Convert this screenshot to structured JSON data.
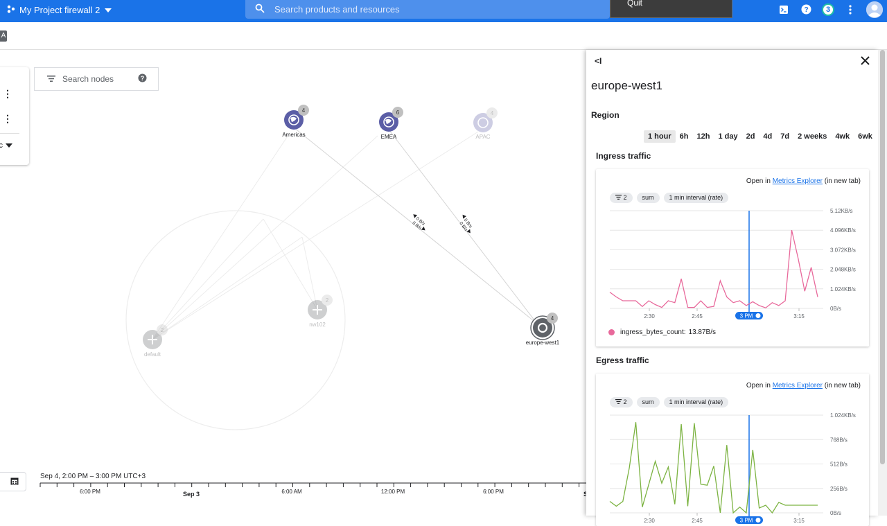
{
  "topbar": {
    "project_name": "My Project firewall 2",
    "search_placeholder": "Search products and resources",
    "quit_label": "Quit",
    "notification_count": "3"
  },
  "chip_label": "A",
  "left_panel": {
    "select_label": "ic"
  },
  "search_nodes_placeholder": "Search nodes",
  "graph": {
    "nodes": [
      {
        "label": "Americas",
        "count": "4"
      },
      {
        "label": "EMEA",
        "count": "6"
      },
      {
        "label": "APAC",
        "count": "4"
      },
      {
        "label": "europe-west1",
        "count": "4"
      },
      {
        "label": "default",
        "count": "2"
      },
      {
        "label": "nw102",
        "count": "2"
      }
    ],
    "edge_labels": [
      "0 B/s",
      "0 B/s",
      "0 B/s",
      "0 B/s"
    ]
  },
  "timeline": {
    "range": "Sep 4, 2:00 PM – 3:00 PM UTC+3",
    "ticks": [
      "6:00 PM",
      "Sep 3",
      "6:00 AM",
      "12:00 PM",
      "6:00 PM",
      "S"
    ]
  },
  "panel": {
    "title": "europe-west1",
    "type": "Region",
    "time_options": [
      "1 hour",
      "6h",
      "12h",
      "1 day",
      "2d",
      "4d",
      "7d",
      "2 weeks",
      "4wk",
      "6wk"
    ],
    "selected_time": "1 hour",
    "open_in_prefix": "Open in",
    "open_in_link": "Metrics Explorer",
    "open_in_suffix": "(in new tab)",
    "chips": [
      "2",
      "sum",
      "1 min interval (rate)"
    ],
    "ingress": {
      "title": "Ingress traffic",
      "legend_label": "ingress_bytes_count:",
      "legend_value": "13.87B/s",
      "color": "#e8699b"
    },
    "egress": {
      "title": "Egress traffic",
      "color": "#7cb342"
    }
  },
  "chart_data": [
    {
      "type": "line",
      "title": "Ingress traffic",
      "x_ticks": [
        "2:30",
        "2:45",
        "3 PM",
        "3:15"
      ],
      "y_ticks": [
        "5.12KB/s",
        "4.096KB/s",
        "3.072KB/s",
        "2.048KB/s",
        "1.024KB/s",
        "0B/s"
      ],
      "ylim": [
        0,
        5.12
      ],
      "y_unit": "KB/s",
      "cursor": "3 PM",
      "series": [
        {
          "values": [
            0.85,
            0.6,
            0.4,
            0.4,
            0.4,
            0.1,
            0.4,
            0.2,
            0.05,
            0.4,
            0.3,
            1.55,
            0.05,
            0.05,
            0.4,
            0.05,
            0.1,
            1.45,
            0.6,
            0.3,
            0.4,
            0.15,
            0.35,
            0.15,
            0.03,
            0.3,
            0.15,
            0.4,
            4.1,
            2.6,
            0.9,
            2.15,
            0.6
          ]
        }
      ]
    },
    {
      "type": "line",
      "title": "Egress traffic",
      "x_ticks": [
        "2:30",
        "2:45",
        "3 PM",
        "3:15"
      ],
      "y_ticks": [
        "1.024KB/s",
        "768B/s",
        "512B/s",
        "256B/s",
        "0B/s"
      ],
      "ylim": [
        0,
        1024
      ],
      "y_unit": "B/s",
      "cursor": "3 PM",
      "series": [
        {
          "values": [
            120,
            70,
            120,
            470,
            950,
            60,
            300,
            540,
            310,
            480,
            90,
            930,
            70,
            940,
            300,
            290,
            490,
            0,
            710,
            0,
            60,
            0,
            660,
            50,
            80,
            0,
            110,
            80,
            80,
            80,
            80,
            80,
            80
          ]
        }
      ]
    }
  ]
}
